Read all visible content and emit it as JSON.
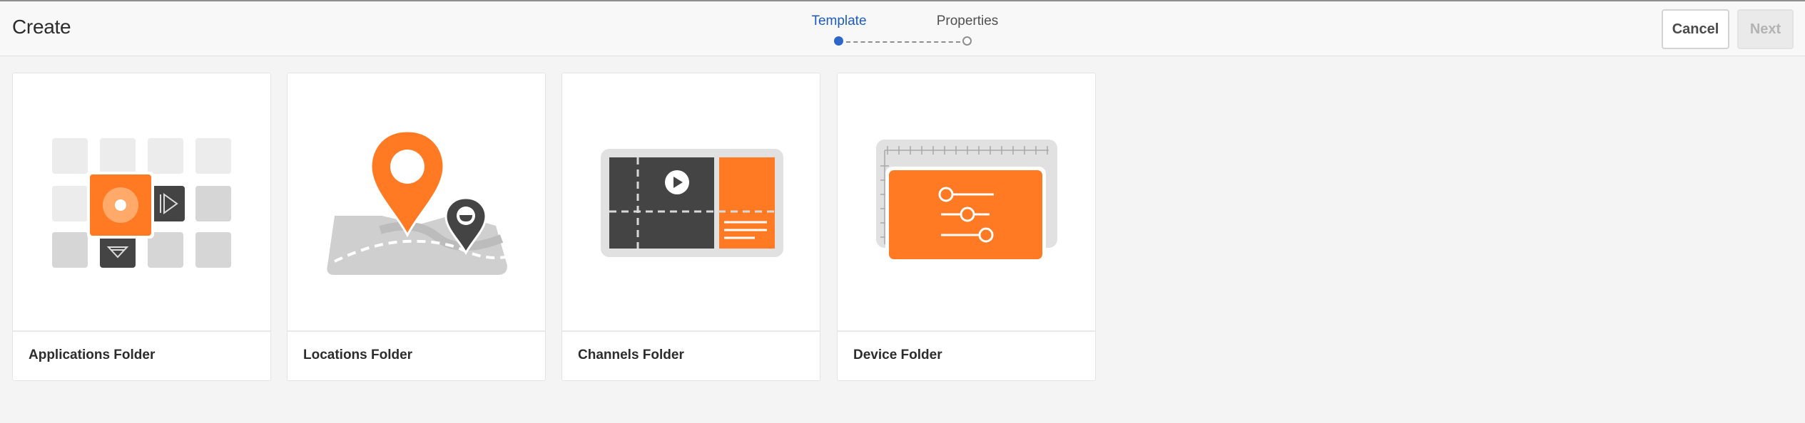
{
  "header": {
    "title": "Create",
    "steps": [
      {
        "label": "Template",
        "state": "active"
      },
      {
        "label": "Properties",
        "state": "inactive"
      }
    ],
    "cancel_label": "Cancel",
    "next_label": "Next"
  },
  "cards": [
    {
      "label": "Applications Folder",
      "icon": "applications-folder-icon"
    },
    {
      "label": "Locations Folder",
      "icon": "locations-folder-icon"
    },
    {
      "label": "Channels Folder",
      "icon": "channels-folder-icon"
    },
    {
      "label": "Device Folder",
      "icon": "device-folder-icon"
    }
  ],
  "colors": {
    "accent": "#ff7a23",
    "dark": "#444444",
    "active_step": "#1d5cbd",
    "page_bg": "#f4f4f4"
  }
}
